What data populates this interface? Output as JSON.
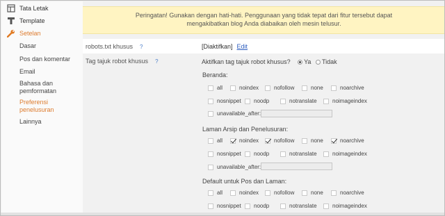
{
  "sidebar": {
    "items": [
      {
        "label": "Tata Letak",
        "icon": "layout-icon"
      },
      {
        "label": "Template",
        "icon": "template-icon"
      },
      {
        "label": "Setelan",
        "icon": "wrench-icon"
      }
    ],
    "subitems": [
      {
        "label": "Dasar"
      },
      {
        "label": "Pos dan komentar"
      },
      {
        "label": "Email"
      },
      {
        "label": "Bahasa dan pemformatan"
      },
      {
        "label": "Preferensi penelusuran"
      },
      {
        "label": "Lainnya"
      }
    ]
  },
  "warning": {
    "text": "Peringatan! Gunakan dengan hati-hati. Penggunaan yang tidak tepat dari fitur tersebut dapat mengakibatkan blog Anda diabaikan oleh mesin telusur."
  },
  "robots_txt": {
    "label": "robots.txt khusus",
    "help": "?",
    "value": "[Diaktifkan]",
    "edit": "Edit"
  },
  "robot_tags": {
    "label": "Tag tajuk robot khusus",
    "help": "?",
    "question": "Aktifkan tag tajuk robot khusus?",
    "yes": "Ya",
    "no": "Tidak",
    "selected": "Ya"
  },
  "groups": [
    {
      "title": "Beranda:",
      "row1": [
        {
          "label": "all",
          "checked": false
        },
        {
          "label": "noindex",
          "checked": false
        },
        {
          "label": "nofollow",
          "checked": false
        },
        {
          "label": "none",
          "checked": false
        },
        {
          "label": "noarchive",
          "checked": false
        }
      ],
      "row2": [
        {
          "label": "nosnippet",
          "checked": false
        },
        {
          "label": "noodp",
          "checked": false
        },
        {
          "label": "notranslate",
          "checked": false
        },
        {
          "label": "noimageindex",
          "checked": false
        }
      ],
      "row3": {
        "label": "unavailable_after:",
        "checked": false,
        "value": ""
      }
    },
    {
      "title": "Laman Arsip dan Penelusuran:",
      "row1": [
        {
          "label": "all",
          "checked": false
        },
        {
          "label": "noindex",
          "checked": true
        },
        {
          "label": "nofollow",
          "checked": true
        },
        {
          "label": "none",
          "checked": false
        },
        {
          "label": "noarchive",
          "checked": true
        }
      ],
      "row2": [
        {
          "label": "nosnippet",
          "checked": false
        },
        {
          "label": "noodp",
          "checked": false
        },
        {
          "label": "notranslate",
          "checked": false
        },
        {
          "label": "noimageindex",
          "checked": false
        }
      ],
      "row3": {
        "label": "unavailable_after:",
        "checked": false,
        "value": ""
      }
    },
    {
      "title": "Default untuk Pos dan Laman:",
      "row1": [
        {
          "label": "all",
          "checked": false
        },
        {
          "label": "noindex",
          "checked": false
        },
        {
          "label": "nofollow",
          "checked": false
        },
        {
          "label": "none",
          "checked": false
        },
        {
          "label": "noarchive",
          "checked": false
        }
      ],
      "row2": [
        {
          "label": "nosnippet",
          "checked": false
        },
        {
          "label": "noodp",
          "checked": false
        },
        {
          "label": "notranslate",
          "checked": false
        },
        {
          "label": "noimageindex",
          "checked": false
        }
      ]
    }
  ],
  "colors": {
    "accent": "#dd7b2e",
    "link": "#2f5fbf",
    "warning_bg": "#fff4c2"
  }
}
